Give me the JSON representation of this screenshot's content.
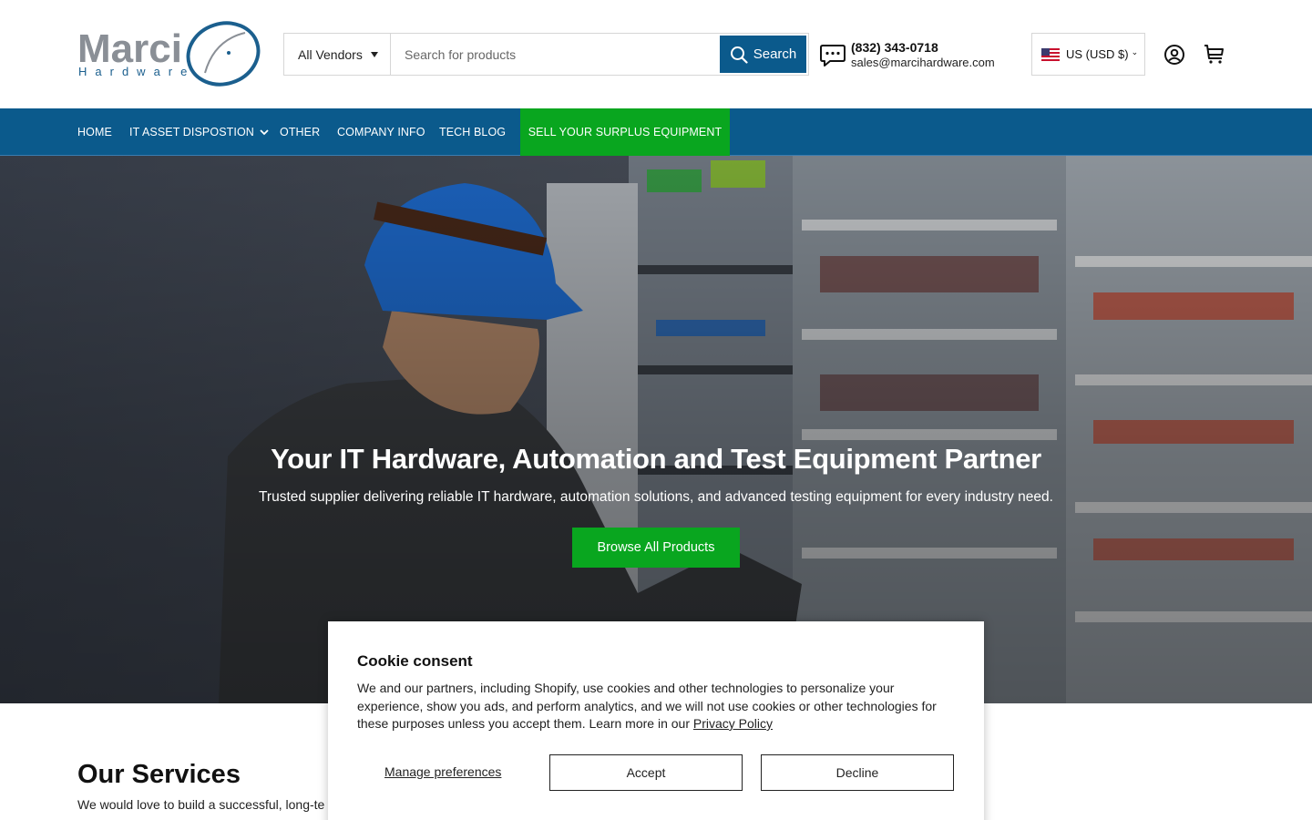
{
  "header": {
    "logo_text": "Marci",
    "logo_subtext": "Hardware",
    "vendor_select": "All Vendors",
    "search": {
      "placeholder": "Search for products",
      "button_label": "Search"
    },
    "contact": {
      "phone": "(832) 343-0718",
      "email": "sales@marcihardware.com"
    },
    "currency": {
      "label": "US (USD $)",
      "flag_icon": "us-flag-icon"
    },
    "icons": {
      "account": "account-icon",
      "cart": "cart-icon",
      "chat": "chat-icon"
    }
  },
  "nav": {
    "items": [
      {
        "label": "HOME"
      },
      {
        "label": "IT ASSET DISPOSTION"
      },
      {
        "label": "OTHER"
      },
      {
        "label": "COMPANY INFO"
      },
      {
        "label": "TECH BLOG"
      },
      {
        "label": "SELL YOUR SURPLUS EQUIPMENT"
      }
    ]
  },
  "hero": {
    "title": "Your IT Hardware, Automation and Test Equipment Partner",
    "subtitle": "Trusted supplier delivering reliable IT hardware, automation solutions, and advanced testing equipment for every industry need.",
    "button_label": "Browse All Products"
  },
  "services": {
    "title": "Our Services",
    "text": "We would love to build a successful, long-te"
  },
  "cookie": {
    "title": "Cookie consent",
    "text": "We and our partners, including Shopify, use cookies and other technologies to personalize your experience, show you ads, and perform analytics, and we will not use cookies or other technologies for these purposes unless you accept them. Learn more in our ",
    "privacy_link": "Privacy Policy",
    "manage_label": "Manage preferences",
    "accept_label": "Accept",
    "decline_label": "Decline"
  },
  "colors": {
    "brand_blue": "#0b5a8c",
    "cta_green": "#09a61f"
  }
}
